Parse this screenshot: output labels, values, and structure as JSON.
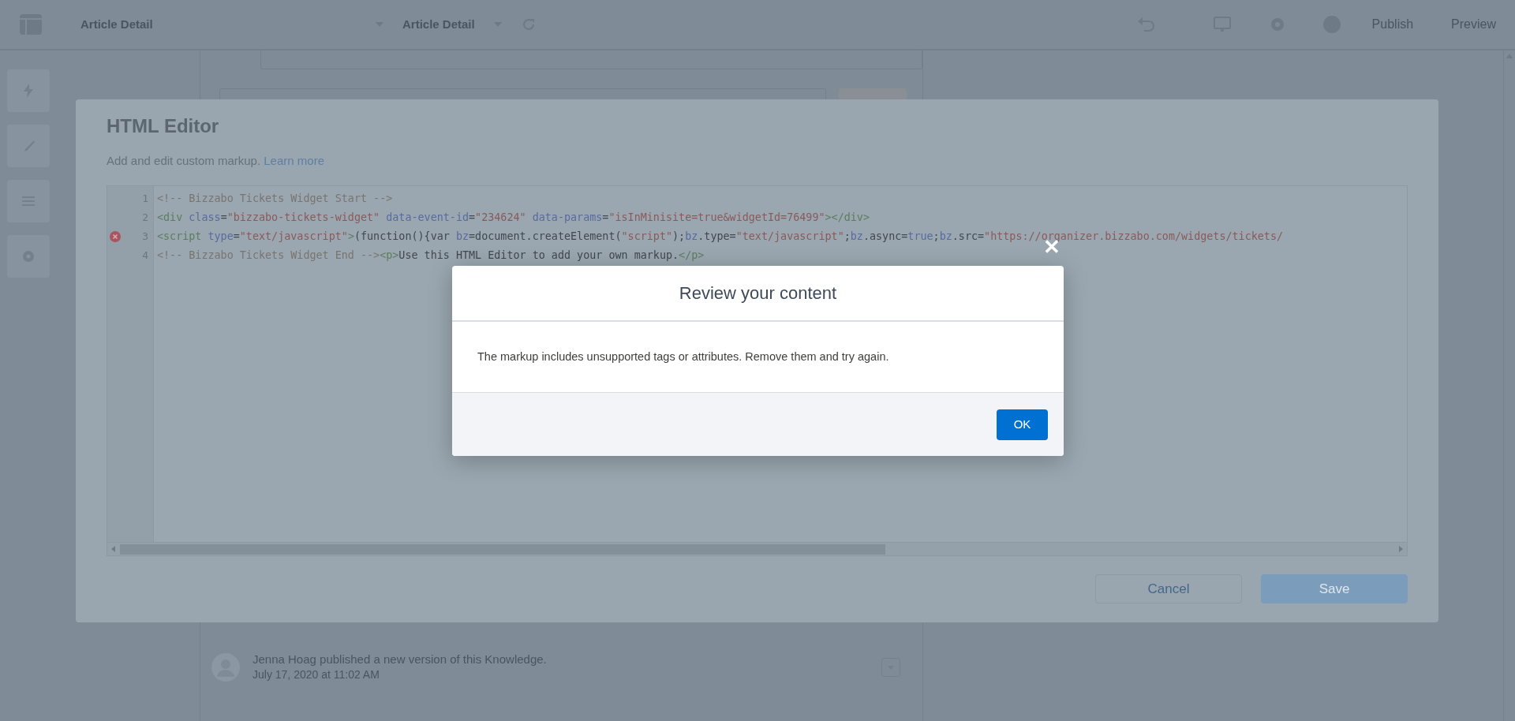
{
  "top_bar": {
    "page_name": "Article Detail",
    "page_variant": "Article Detail",
    "actions": [
      "Publish",
      "Preview"
    ]
  },
  "activity": {
    "text": "Jenna Hoag published a new version of this Knowledge.",
    "time": "July 17, 2020 at 11:02 AM"
  },
  "html_editor": {
    "title": "HTML Editor",
    "description": "Add and edit custom markup.",
    "link": "Learn more",
    "lines": [
      {
        "number": "1",
        "error": false,
        "tokens": [
          {
            "kind": "comment",
            "text": "<!-- Bizzabo Tickets Widget Start -->"
          }
        ]
      },
      {
        "number": "2",
        "error": false,
        "tokens": [
          {
            "kind": "tag",
            "text": "<div"
          },
          {
            "kind": "attr",
            "text": " class"
          },
          {
            "kind": "plain",
            "text": "="
          },
          {
            "kind": "string",
            "text": "\"bizzabo-tickets-widget\""
          },
          {
            "kind": "attr",
            "text": " data-event-id"
          },
          {
            "kind": "plain",
            "text": "="
          },
          {
            "kind": "string",
            "text": "\"234624\""
          },
          {
            "kind": "attr",
            "text": " data-params"
          },
          {
            "kind": "plain",
            "text": "="
          },
          {
            "kind": "string",
            "text": "\"isInMinisite=true&widgetId=76499\""
          },
          {
            "kind": "tag",
            "text": "></div>"
          }
        ]
      },
      {
        "number": "3",
        "error": true,
        "tokens": [
          {
            "kind": "tag",
            "text": "<script"
          },
          {
            "kind": "attr",
            "text": " type"
          },
          {
            "kind": "plain",
            "text": "="
          },
          {
            "kind": "string",
            "text": "\"text/javascript\""
          },
          {
            "kind": "tag",
            "text": ">"
          },
          {
            "kind": "plain",
            "text": "(function(){var "
          },
          {
            "kind": "attr",
            "text": "bz"
          },
          {
            "kind": "plain",
            "text": "=document.createElement("
          },
          {
            "kind": "string",
            "text": "\"script\""
          },
          {
            "kind": "plain",
            "text": ");"
          },
          {
            "kind": "attr",
            "text": "bz"
          },
          {
            "kind": "plain",
            "text": ".type="
          },
          {
            "kind": "string",
            "text": "\"text/javascript\""
          },
          {
            "kind": "plain",
            "text": ";"
          },
          {
            "kind": "attr",
            "text": "bz"
          },
          {
            "kind": "plain",
            "text": ".async="
          },
          {
            "kind": "attr",
            "text": "true"
          },
          {
            "kind": "plain",
            "text": ";"
          },
          {
            "kind": "attr",
            "text": "bz"
          },
          {
            "kind": "plain",
            "text": ".src="
          },
          {
            "kind": "string",
            "text": "\"https://organizer.bizzabo.com/widgets/tickets/"
          }
        ]
      },
      {
        "number": "4",
        "error": false,
        "tokens": [
          {
            "kind": "comment",
            "text": "<!-- Bizzabo Tickets Widget End -->"
          },
          {
            "kind": "tag",
            "text": "<p>"
          },
          {
            "kind": "plain",
            "text": "Use this HTML Editor to add your own markup."
          },
          {
            "kind": "tag",
            "text": "</p>"
          }
        ]
      }
    ],
    "buttons": [
      {
        "label": "Cancel",
        "kind": "neutral"
      },
      {
        "label": "Save",
        "kind": "brand"
      }
    ]
  },
  "alert": {
    "close": "✕",
    "title": "Review your content",
    "message": "The markup includes unsupported tags or attributes. Remove them and try again.",
    "button": "OK"
  }
}
